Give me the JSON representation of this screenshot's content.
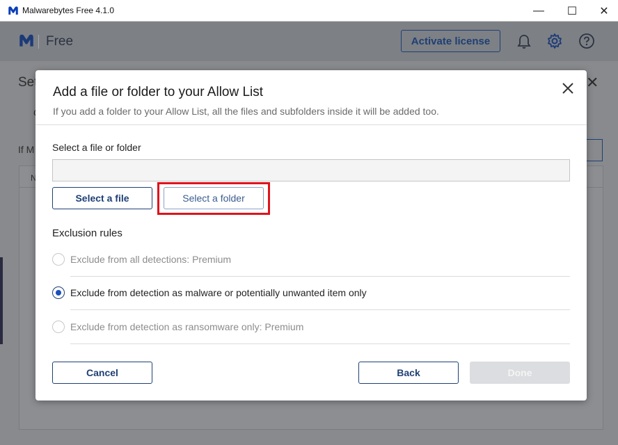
{
  "window": {
    "title": "Malwarebytes Free  4.1.0",
    "minimize_glyph": "—",
    "maximize_glyph": "☐",
    "close_glyph": "✕"
  },
  "app": {
    "edition": "Free",
    "activate_label": "Activate license",
    "brand_color": "#1e3f74",
    "background_panel": {
      "title_partial": "Set",
      "tab_partial": "C",
      "text_partial": "If M",
      "column_partial": "N"
    }
  },
  "dialog": {
    "title": "Add a file or folder to your Allow List",
    "subtitle": "If you add a folder to your Allow List, all the files and subfolders inside it will be added too.",
    "select_label": "Select a file or folder",
    "path_value": "",
    "path_placeholder": "",
    "select_file_label": "Select a file",
    "select_folder_label": "Select a folder",
    "highlight_color": "#e0121c",
    "rules_label": "Exclusion rules",
    "rules": [
      {
        "label": "Exclude from all detections: Premium",
        "checked": false,
        "disabled": true
      },
      {
        "label": "Exclude from detection as malware or potentially unwanted item only",
        "checked": true,
        "disabled": false
      },
      {
        "label": "Exclude from detection as ransomware only: Premium",
        "checked": false,
        "disabled": true
      }
    ],
    "cancel_label": "Cancel",
    "back_label": "Back",
    "done_label": "Done"
  }
}
